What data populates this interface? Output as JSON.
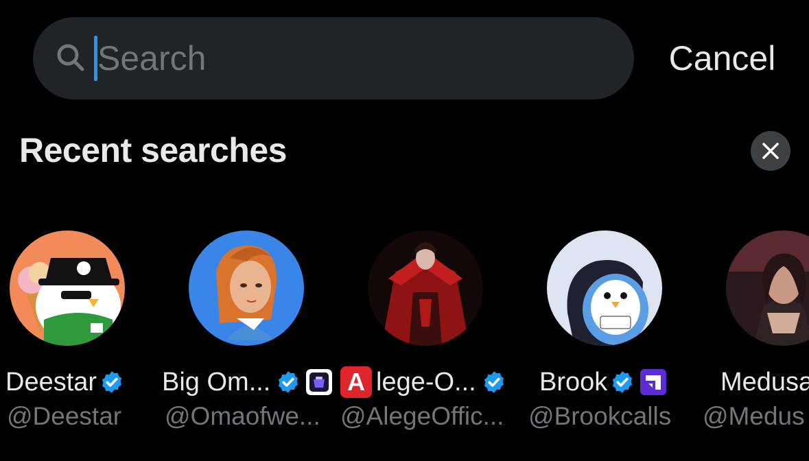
{
  "search": {
    "placeholder": "Search",
    "value": "",
    "cancel_label": "Cancel"
  },
  "recent": {
    "title": "Recent searches",
    "users": [
      {
        "name": "Deestar",
        "handle": "@Deestar",
        "verified": true
      },
      {
        "name": "Big Om...",
        "handle": "@Omaofwe...",
        "verified": true
      },
      {
        "name_badge": "A",
        "name": "lege-O...",
        "handle": "@AlegeOffic...",
        "verified": true
      },
      {
        "name": "Brook",
        "handle": "@Brookcalls",
        "verified": true
      },
      {
        "name": "Medusa",
        "handle": "@Medus"
      }
    ]
  },
  "colors": {
    "background": "#000000",
    "search_bg": "#202327",
    "accent": "#1d9bf0",
    "secondary_text": "#71767b",
    "primary_text": "#e7e9ea"
  }
}
